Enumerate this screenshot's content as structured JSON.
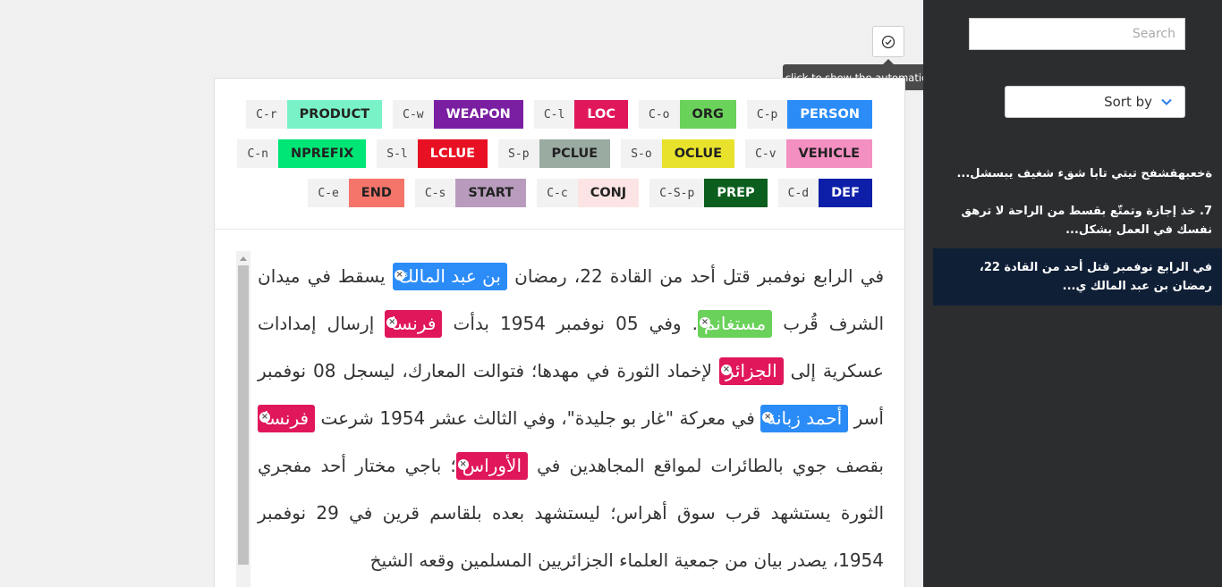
{
  "toolbar": {
    "auto_annotations_tooltip": "click to show the automatic annotations",
    "auto_annotations_icon": "check-circle-icon"
  },
  "labels": {
    "row1": [
      {
        "key": "C-p",
        "name": "PERSON",
        "color": "#2b8cf7",
        "text_color": "#ffffff"
      },
      {
        "key": "C-o",
        "name": "ORG",
        "color": "#6ad15b",
        "text_color": "#222222"
      },
      {
        "key": "C-l",
        "name": "LOC",
        "color": "#e0175a",
        "text_color": "#ffffff"
      },
      {
        "key": "C-w",
        "name": "WEAPON",
        "color": "#7b1fa2",
        "text_color": "#ffffff"
      },
      {
        "key": "C-r",
        "name": "PRODUCT",
        "color": "#7af2c8",
        "text_color": "#222222"
      }
    ],
    "row2": [
      {
        "key": "C-v",
        "name": "VEHICLE",
        "color": "#f48fc1",
        "text_color": "#222222"
      },
      {
        "key": "S-o",
        "name": "OCLUE",
        "color": "#e8e22c",
        "text_color": "#222222"
      },
      {
        "key": "S-p",
        "name": "PCLUE",
        "color": "#9aaba1",
        "text_color": "#222222"
      },
      {
        "key": "S-l",
        "name": "LCLUE",
        "color": "#e81123",
        "text_color": "#ffffff"
      },
      {
        "key": "C-n",
        "name": "NPREFIX",
        "color": "#00e676",
        "text_color": "#222222"
      }
    ],
    "row3": [
      {
        "key": "C-d",
        "name": "DEF",
        "color": "#0d1fa8",
        "text_color": "#ffffff"
      },
      {
        "key": "C-S-p",
        "name": "PREP",
        "color": "#0b5e1e",
        "text_color": "#ffffff"
      },
      {
        "key": "C-c",
        "name": "CONJ",
        "color": "#fde4e4",
        "text_color": "#222222"
      },
      {
        "key": "C-s",
        "name": "START",
        "color": "#b99cbd",
        "text_color": "#222222"
      },
      {
        "key": "C-e",
        "name": "END",
        "color": "#f5756a",
        "text_color": "#222222"
      }
    ]
  },
  "document": {
    "segments": [
      {
        "t": "في الرابع نوفمبر قتل أحد من القادة 22، رمضان "
      },
      {
        "e": "بن عبد المالك",
        "label": "PERSON",
        "color": "#2b8cf7"
      },
      {
        "t": " يسقط في ميدان الشرف قُرب "
      },
      {
        "e": "مستغانم",
        "label": "ORG",
        "color": "#6ad15b"
      },
      {
        "t": ". وفي 05 نوفمبر 1954 بدأت "
      },
      {
        "e": "فرنسا",
        "label": "LOC",
        "color": "#e0175a"
      },
      {
        "t": " إرسال إمدادات عسكرية إلى "
      },
      {
        "e": "الجزائر",
        "label": "LOC",
        "color": "#e0175a"
      },
      {
        "t": " لإخماد الثورة في مهدها؛ فتوالت المعارك، ليسجل 08 نوفمبر أسر "
      },
      {
        "e": "أحمد زبانة",
        "label": "PERSON",
        "color": "#2b8cf7"
      },
      {
        "t": " في معركة \"غار بو جليدة\"، وفي الثالث عشر 1954 شرعت "
      },
      {
        "e": "فرنسا",
        "label": "LOC",
        "color": "#e0175a"
      },
      {
        "t": " بقصف جوي بالطائرات لمواقع المجاهدين في "
      },
      {
        "e": "الأوراس",
        "label": "LOC",
        "color": "#e0175a"
      },
      {
        "t": "؛ باجي مختار أحد مفجري الثورة يستشهد قرب سوق أهراس؛ ليستشهد بعده بلقاسم قرين في 29 نوفمبر 1954، يصدر بيان من جمعية العلماء الجزائريين المسلمين وقعه الشيخ"
      }
    ]
  },
  "sidebar": {
    "search_placeholder": "Search",
    "sort_label": "Sort by",
    "sort_icon": "chevron-down-icon",
    "documents": [
      "ةخعبهقشفح تيتي تابا شقء شغيف يبسشل...",
      "7. خذ إجازة وتمتّع بقسط من الراحة لا ترهق نفسك في العمل بشكل...",
      "في الرابع نوفمبر قتل أحد من القادة 22، رمضان بن عبد المالك ي..."
    ]
  }
}
